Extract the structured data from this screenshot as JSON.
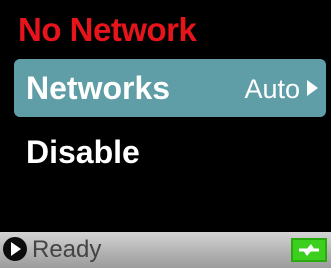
{
  "screen": {
    "title": "No Network"
  },
  "menu": {
    "items": [
      {
        "label": "Networks",
        "value": "Auto",
        "selected": true
      },
      {
        "label": "Disable"
      }
    ]
  },
  "status_bar": {
    "status_icon": "play-circle-icon",
    "status_text": "Ready",
    "power_icon": "charging-plug-icon"
  },
  "colors": {
    "title": "#e8141b",
    "selected_row": "#5f9ea6",
    "power_indicator": "#3ccf1e"
  }
}
